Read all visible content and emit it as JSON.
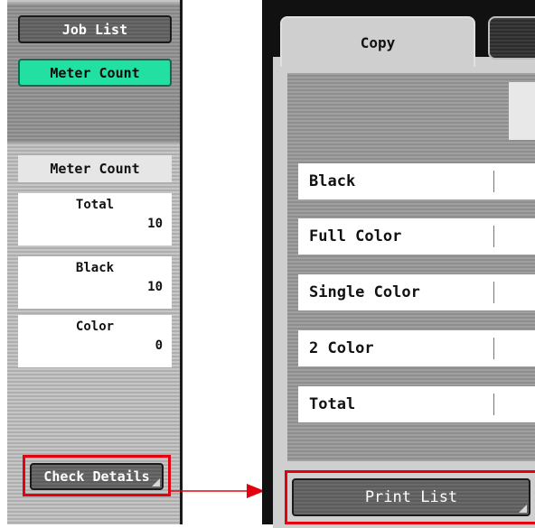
{
  "left_panel": {
    "job_list_label": "Job List",
    "meter_count_label": "Meter Count",
    "meter_header": "Meter Count",
    "counters": [
      {
        "label": "Total",
        "value": "10"
      },
      {
        "label": "Black",
        "value": "10"
      },
      {
        "label": "Color",
        "value": "0"
      }
    ],
    "check_details_label": "Check Details"
  },
  "right_panel": {
    "tabs": [
      {
        "label": "Copy"
      }
    ],
    "rows": [
      {
        "label": "Black"
      },
      {
        "label": "Full Color"
      },
      {
        "label": "Single Color"
      },
      {
        "label": "2 Color"
      },
      {
        "label": "Total"
      }
    ],
    "print_list_label": "Print List"
  },
  "colors": {
    "highlight": "#e3000f",
    "meter_count_active": "#22e0a2",
    "arrow": "#e3000f"
  },
  "icons": {
    "arrow": "arrow-right-icon"
  }
}
